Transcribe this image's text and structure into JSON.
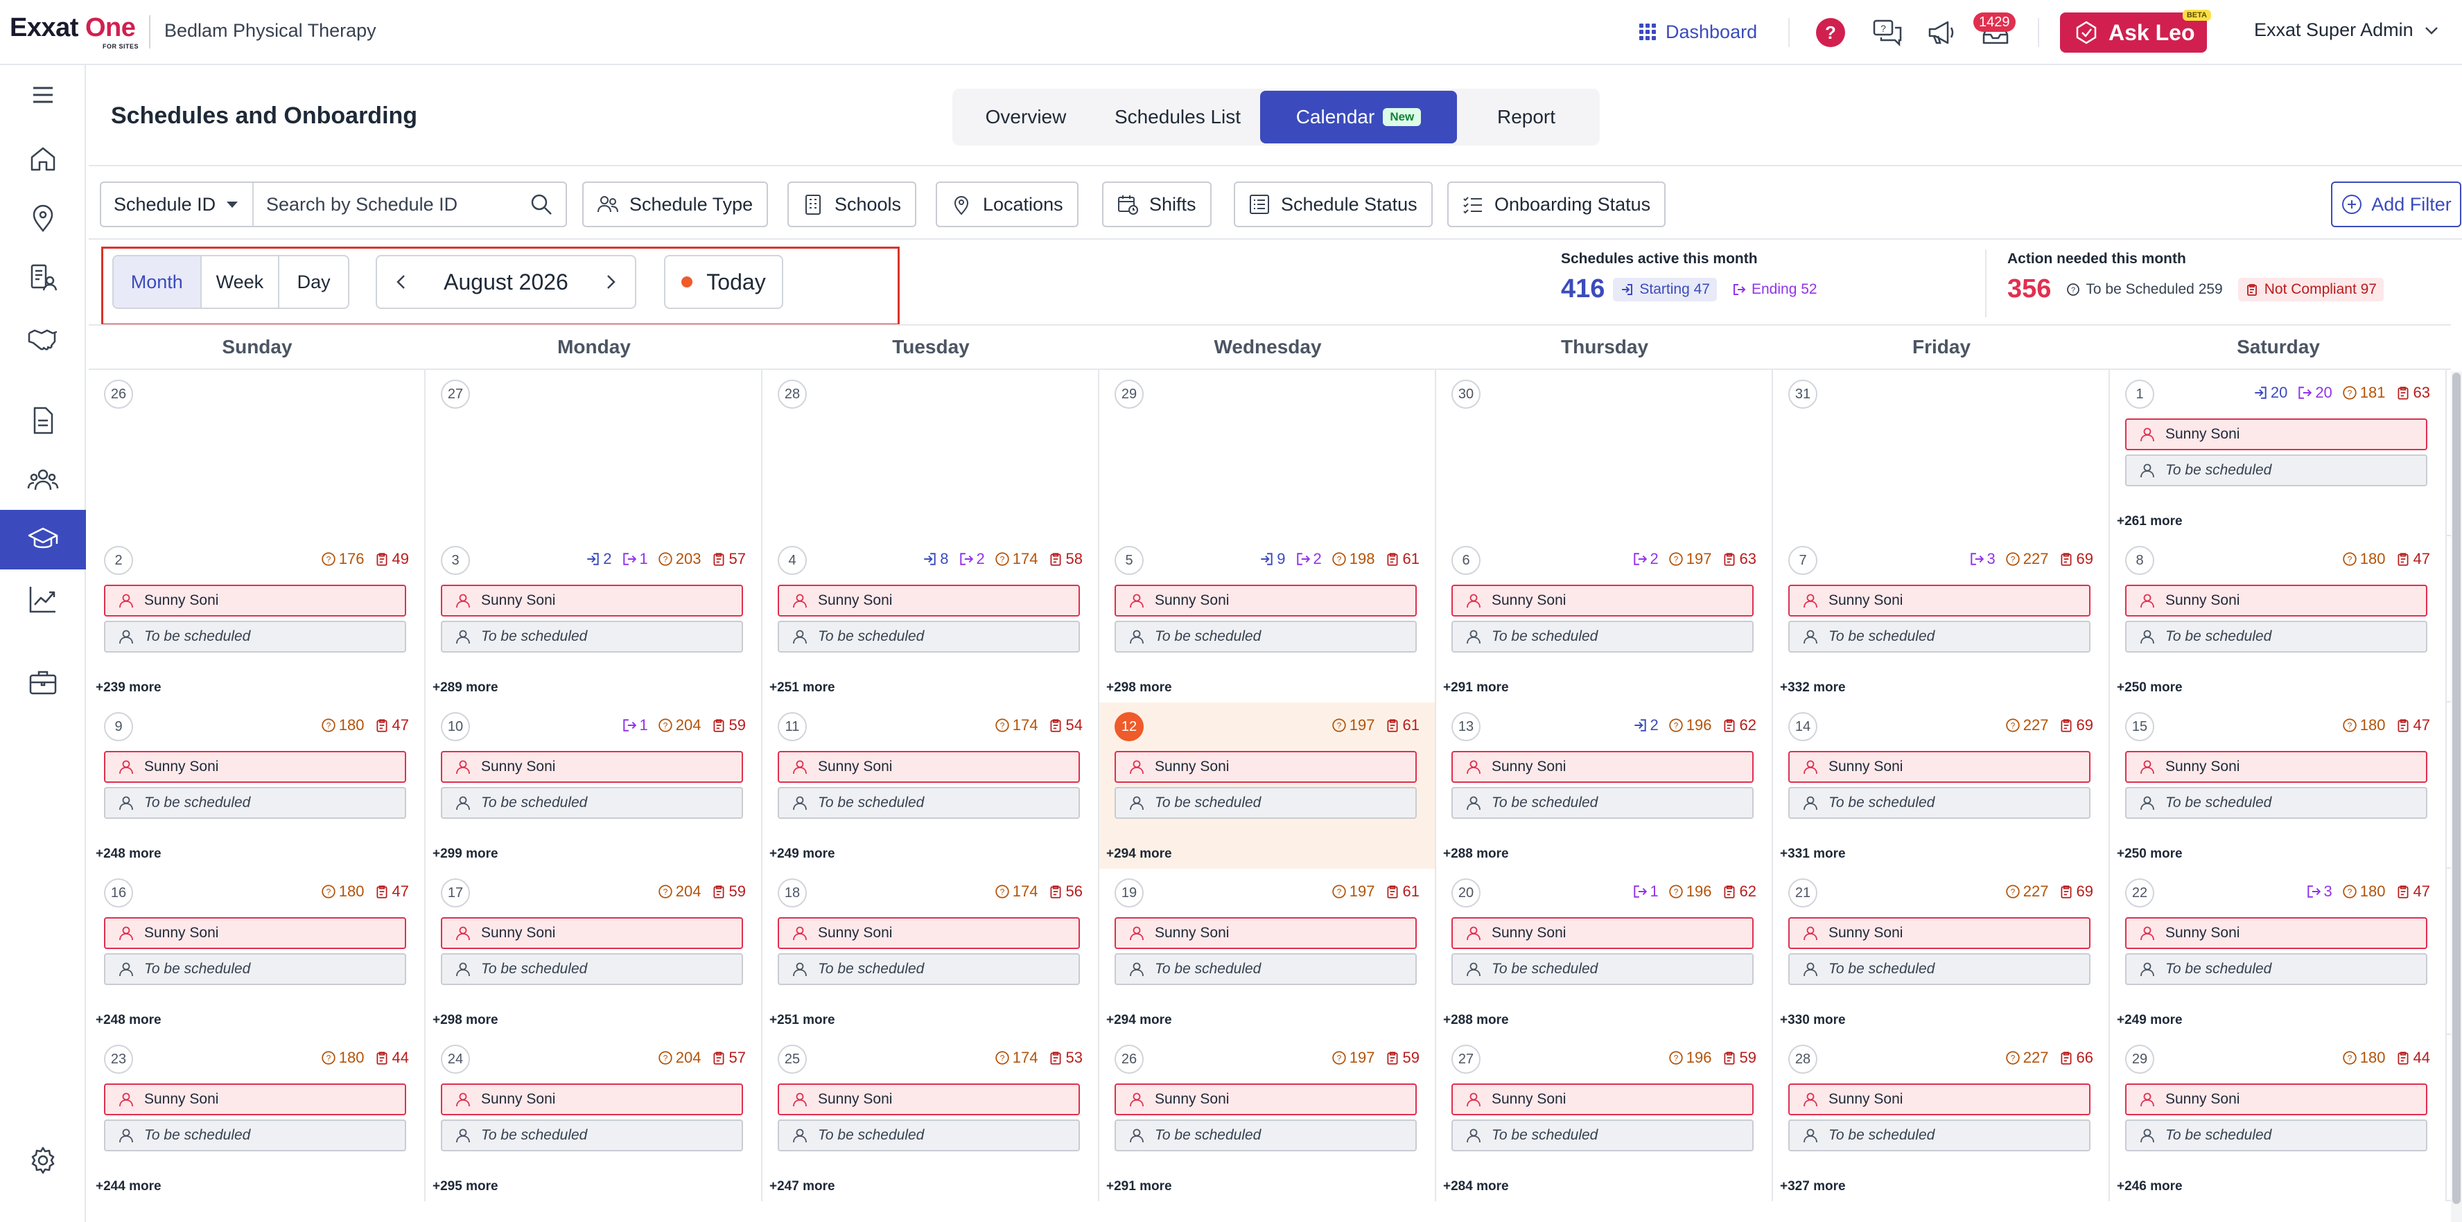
{
  "header": {
    "logo_text": "Exxat",
    "logo_text_accent": "One",
    "logo_tagline": "FOR SITES",
    "org_name": "Bedlam Physical Therapy",
    "dashboard_label": "Dashboard",
    "notification_count": "1429",
    "ask_leo_label": "Ask Leo",
    "ask_leo_badge": "BETA",
    "user_name": "Exxat Super Admin"
  },
  "page": {
    "title": "Schedules and Onboarding",
    "tabs": [
      {
        "label": "Overview",
        "active": false
      },
      {
        "label": "Schedules List",
        "active": false
      },
      {
        "label": "Calendar",
        "active": true,
        "badge": "New"
      },
      {
        "label": "Report",
        "active": false
      }
    ]
  },
  "filters": {
    "search_field": "Schedule ID",
    "search_placeholder": "Search by Schedule ID",
    "buttons": [
      "Schedule Type",
      "Schools",
      "Locations",
      "Shifts",
      "Schedule Status",
      "Onboarding Status"
    ],
    "add_filter_label": "Add Filter"
  },
  "toolbar": {
    "views": [
      {
        "label": "Month",
        "active": true
      },
      {
        "label": "Week",
        "active": false
      },
      {
        "label": "Day",
        "active": false
      }
    ],
    "current_period": "August 2026",
    "today_label": "Today"
  },
  "stats": {
    "active": {
      "heading": "Schedules active this month",
      "count": "416",
      "starting": "Starting 47",
      "ending": "Ending 52"
    },
    "action": {
      "heading": "Action needed this month",
      "count": "356",
      "to_schedule": "To be Scheduled 259",
      "not_compliant": "Not Compliant 97"
    }
  },
  "calendar": {
    "day_names": [
      "Sunday",
      "Monday",
      "Tuesday",
      "Wednesday",
      "Thursday",
      "Friday",
      "Saturday"
    ],
    "event_name": "Sunny Soni",
    "event_status": "To be scheduled",
    "weeks": [
      [
        {
          "day": "26",
          "muted": true
        },
        {
          "day": "27",
          "muted": true
        },
        {
          "day": "28",
          "muted": true
        },
        {
          "day": "29",
          "muted": true
        },
        {
          "day": "30",
          "muted": true
        },
        {
          "day": "31",
          "muted": true
        },
        {
          "day": "1",
          "start": "20",
          "end": "20",
          "tbs": "181",
          "nc": "63",
          "more": "+261 more"
        }
      ],
      [
        {
          "day": "2",
          "tbs": "176",
          "nc": "49",
          "more": "+239 more"
        },
        {
          "day": "3",
          "start": "2",
          "end": "1",
          "tbs": "203",
          "nc": "57",
          "more": "+289 more"
        },
        {
          "day": "4",
          "start": "8",
          "end": "2",
          "tbs": "174",
          "nc": "58",
          "more": "+251 more"
        },
        {
          "day": "5",
          "start": "9",
          "end": "2",
          "tbs": "198",
          "nc": "61",
          "more": "+298 more"
        },
        {
          "day": "6",
          "end": "2",
          "tbs": "197",
          "nc": "63",
          "more": "+291 more"
        },
        {
          "day": "7",
          "end": "3",
          "tbs": "227",
          "nc": "69",
          "more": "+332 more"
        },
        {
          "day": "8",
          "tbs": "180",
          "nc": "47",
          "more": "+250 more"
        }
      ],
      [
        {
          "day": "9",
          "tbs": "180",
          "nc": "47",
          "more": "+248 more"
        },
        {
          "day": "10",
          "end": "1",
          "tbs": "204",
          "nc": "59",
          "more": "+299 more"
        },
        {
          "day": "11",
          "tbs": "174",
          "nc": "54",
          "more": "+249 more"
        },
        {
          "day": "12",
          "today": true,
          "tbs": "197",
          "nc": "61",
          "more": "+294 more"
        },
        {
          "day": "13",
          "start": "2",
          "tbs": "196",
          "nc": "62",
          "more": "+288 more"
        },
        {
          "day": "14",
          "tbs": "227",
          "nc": "69",
          "more": "+331 more"
        },
        {
          "day": "15",
          "tbs": "180",
          "nc": "47",
          "more": "+250 more"
        }
      ],
      [
        {
          "day": "16",
          "tbs": "180",
          "nc": "47",
          "more": "+248 more"
        },
        {
          "day": "17",
          "tbs": "204",
          "nc": "59",
          "more": "+298 more"
        },
        {
          "day": "18",
          "tbs": "174",
          "nc": "56",
          "more": "+251 more"
        },
        {
          "day": "19",
          "tbs": "197",
          "nc": "61",
          "more": "+294 more"
        },
        {
          "day": "20",
          "end": "1",
          "tbs": "196",
          "nc": "62",
          "more": "+288 more"
        },
        {
          "day": "21",
          "tbs": "227",
          "nc": "69",
          "more": "+330 more"
        },
        {
          "day": "22",
          "end": "3",
          "tbs": "180",
          "nc": "47",
          "more": "+249 more"
        }
      ],
      [
        {
          "day": "23",
          "tbs": "180",
          "nc": "44",
          "more": "+244 more"
        },
        {
          "day": "24",
          "tbs": "204",
          "nc": "57",
          "more": "+295 more"
        },
        {
          "day": "25",
          "tbs": "174",
          "nc": "53",
          "more": "+247 more"
        },
        {
          "day": "26",
          "tbs": "197",
          "nc": "59",
          "more": "+291 more"
        },
        {
          "day": "27",
          "tbs": "196",
          "nc": "59",
          "more": "+284 more"
        },
        {
          "day": "28",
          "tbs": "227",
          "nc": "66",
          "more": "+327 more"
        },
        {
          "day": "29",
          "tbs": "180",
          "nc": "44",
          "more": "+246 more"
        }
      ]
    ]
  },
  "colors": {
    "primary": "#3b4bbd",
    "brand": "#d1204f",
    "today": "#ef5b2a"
  }
}
